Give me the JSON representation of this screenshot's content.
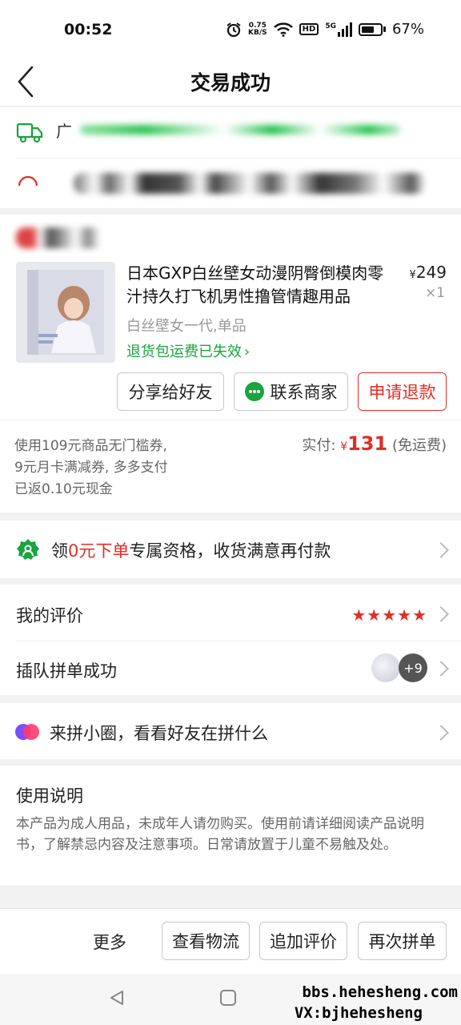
{
  "status_bar": {
    "time": "00:52",
    "net_speed_value": "0.75",
    "net_speed_unit": "KB/S",
    "hd_label": "HD",
    "signal_label": "5G",
    "battery_percent": "67%",
    "battery_level": 0.67
  },
  "header": {
    "title": "交易成功"
  },
  "shipping": {
    "line1_prefix": "广"
  },
  "product": {
    "name": "日本GXP白丝壁女动漫阴臀倒模肉零汁持久打飞机男性撸管情趣用品",
    "price_symbol": "¥",
    "price": "249",
    "quantity": "×1",
    "spec": "白丝壁女一代,单品",
    "refund_notice": "退货包运费已失效",
    "refund_notice_arrow": "›"
  },
  "actions": {
    "share": "分享给好友",
    "contact": "联系商家",
    "refund": "申请退款"
  },
  "payment": {
    "coupon_line1": "使用109元商品无门槛券,",
    "coupon_line2": "9元月卡满减券, 多多支付",
    "coupon_line3": "已返0.10元现金",
    "paid_label": "实付:",
    "currency": "¥",
    "amount": "131",
    "shipping_note": "(免运费)"
  },
  "promo": {
    "prefix": "领",
    "highlight": "0元下单",
    "suffix": "专属资格，收货满意再付款"
  },
  "review": {
    "label": "我的评价",
    "stars": "★★★★★",
    "rating": 5
  },
  "group": {
    "label": "插队拼单成功",
    "extra_count": "+9"
  },
  "circle": {
    "label": "来拼小圈，看看好友在拼什么"
  },
  "instructions": {
    "title": "使用说明",
    "body": "本产品为成人用品，未成年人请勿购买。使用前请详细阅读产品说明书，了解禁忌内容及注意事项。日常请放置于儿童不易触及处。"
  },
  "bottom_bar": {
    "more": "更多",
    "logistics": "查看物流",
    "add_review": "追加评价",
    "reorder": "再次拼单"
  },
  "watermark": {
    "line1": "bbs.hehesheng.com",
    "line2": "VX:bjhehesheng"
  },
  "colors": {
    "brand_red": "#e02e24",
    "green": "#1aa33e",
    "text_gray": "#999999"
  }
}
